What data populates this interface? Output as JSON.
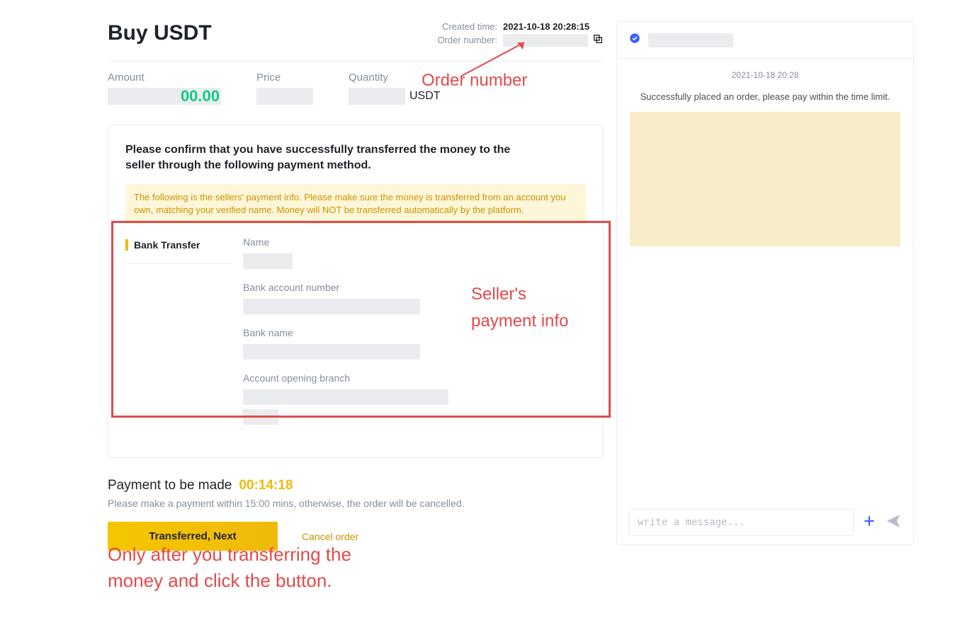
{
  "header": {
    "title": "Buy USDT",
    "created_time_label": "Created time:",
    "created_time_value": "2021-10-18 20:28:15",
    "order_number_label": "Order number:"
  },
  "summary": {
    "amount_label": "Amount",
    "amount_partial": "00.00",
    "price_label": "Price",
    "quantity_label": "Quantity",
    "quantity_unit": "USDT"
  },
  "confirm": {
    "title": "Please confirm that you have successfully transferred the money to the seller through the following payment method.",
    "warning": "The following is the sellers' payment info. Please make sure the money is transferred from an account you own, matching your verified name. Money will NOT be transferred automatically by the platform."
  },
  "payment": {
    "tab_label": "Bank Transfer",
    "name_label": "Name",
    "account_label": "Bank account number",
    "bank_label": "Bank name",
    "branch_label": "Account opening branch"
  },
  "countdown": {
    "label": "Payment to be made",
    "time": "00:14:18",
    "hint": "Please make a payment within 15:00 mins, otherwise, the order will be cancelled."
  },
  "actions": {
    "transferred_next": "Transferred, Next",
    "cancel": "Cancel order"
  },
  "chat": {
    "timestamp": "2021-10-18 20:28",
    "info": "Successfully placed an order, please pay within the time limit.",
    "input_placeholder": "write a message..."
  },
  "annotations": {
    "order_number": "Order number",
    "seller_info1": "Seller's",
    "seller_info2": "payment info",
    "bottom1": "Only after you transferring the",
    "bottom2": "money and click the button."
  }
}
